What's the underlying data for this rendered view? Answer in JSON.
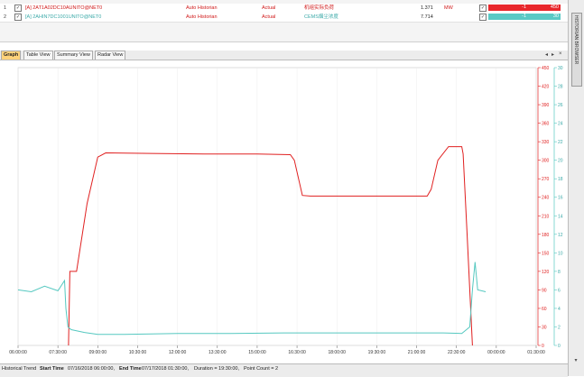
{
  "trend_table": {
    "rows": [
      {
        "index": "1",
        "tag": "[A] 2AT1A02DC10AUNITO@NET0",
        "source": "Auto Historian",
        "mode": "Actual",
        "desc": "机组实际负荷",
        "value": "1.371",
        "units": "MW",
        "pct": "-1",
        "max": "450",
        "bar_color": "#e8262b",
        "text_color": "#d01818"
      },
      {
        "index": "2",
        "tag": "[A] 2AHIN7DC1001UNITO@NET0",
        "source": "Auto Historian",
        "mode": "Actual",
        "desc": "CEMS烟尘浓度",
        "value": "7.714",
        "units": "",
        "pct": "-1",
        "max": "30",
        "bar_color": "#59c9c5",
        "text_color": "#3aa9a8"
      }
    ]
  },
  "right_panel": {
    "tab_label": "HISTORIAN BROWSER"
  },
  "tabs": [
    {
      "label": "Graph",
      "active": true
    },
    {
      "label": "Table View",
      "active": false
    },
    {
      "label": "Summary View",
      "active": false
    },
    {
      "label": "Radar View",
      "active": false
    }
  ],
  "tab_controls": {
    "prev": "◂",
    "next": "▸",
    "close": "×"
  },
  "chart_data": {
    "type": "line",
    "x_ticks": [
      "06:00:00",
      "07:30:00",
      "09:00:00",
      "10:30:00",
      "12:00:00",
      "13:30:00",
      "15:00:00",
      "16:30:00",
      "18:00:00",
      "19:30:00",
      "21:00:00",
      "22:30:00",
      "00:00:00",
      "01:30:00"
    ],
    "x_range": [
      0,
      19.5
    ],
    "y_left_ticks": [
      0,
      30,
      60,
      90,
      120,
      150,
      180,
      210,
      240,
      270,
      300,
      330,
      360,
      390,
      420,
      450
    ],
    "y_left_range": [
      0,
      450
    ],
    "y_right_ticks": [
      0,
      2,
      4,
      6,
      8,
      10,
      12,
      14,
      16,
      18,
      20,
      22,
      24,
      26,
      28,
      30
    ],
    "y_right_range": [
      0,
      30
    ],
    "series": [
      {
        "color": "#e02020",
        "axis": "left",
        "points": [
          [
            1.9,
            0
          ],
          [
            1.95,
            120
          ],
          [
            2.2,
            120
          ],
          [
            2.6,
            230
          ],
          [
            3.0,
            305
          ],
          [
            3.3,
            312
          ],
          [
            5,
            311
          ],
          [
            7,
            310
          ],
          [
            9,
            310
          ],
          [
            10.25,
            309
          ],
          [
            10.4,
            300
          ],
          [
            10.7,
            243
          ],
          [
            11,
            242
          ],
          [
            13,
            242
          ],
          [
            15.4,
            242
          ],
          [
            15.55,
            253
          ],
          [
            15.8,
            300
          ],
          [
            16.2,
            322
          ],
          [
            16.7,
            322
          ],
          [
            16.75,
            310
          ],
          [
            16.9,
            180
          ],
          [
            17.1,
            0
          ]
        ]
      },
      {
        "color": "#55c8c0",
        "axis": "right",
        "points": [
          [
            0,
            6
          ],
          [
            0.5,
            5.8
          ],
          [
            1,
            6.4
          ],
          [
            1.5,
            5.9
          ],
          [
            1.75,
            7
          ],
          [
            1.8,
            4
          ],
          [
            1.88,
            2
          ],
          [
            2,
            1.7
          ],
          [
            2.5,
            1.4
          ],
          [
            3,
            1.2
          ],
          [
            4,
            1.2
          ],
          [
            6,
            1.3
          ],
          [
            8,
            1.3
          ],
          [
            10,
            1.35
          ],
          [
            12,
            1.35
          ],
          [
            14,
            1.35
          ],
          [
            16,
            1.35
          ],
          [
            16.7,
            1.3
          ],
          [
            17,
            2
          ],
          [
            17.1,
            6
          ],
          [
            17.2,
            9
          ],
          [
            17.3,
            6
          ],
          [
            17.6,
            5.8
          ]
        ]
      }
    ]
  },
  "status_bar": {
    "label": "Historical Trend",
    "start_label": "Start Time",
    "start_value": "07/16/2018 06:00:00,",
    "end_label": "End Time",
    "end_value": "07/17/2018 01:30:00,",
    "duration": "Duration = 19:30:00,",
    "point_count": "Point Count = 2"
  }
}
